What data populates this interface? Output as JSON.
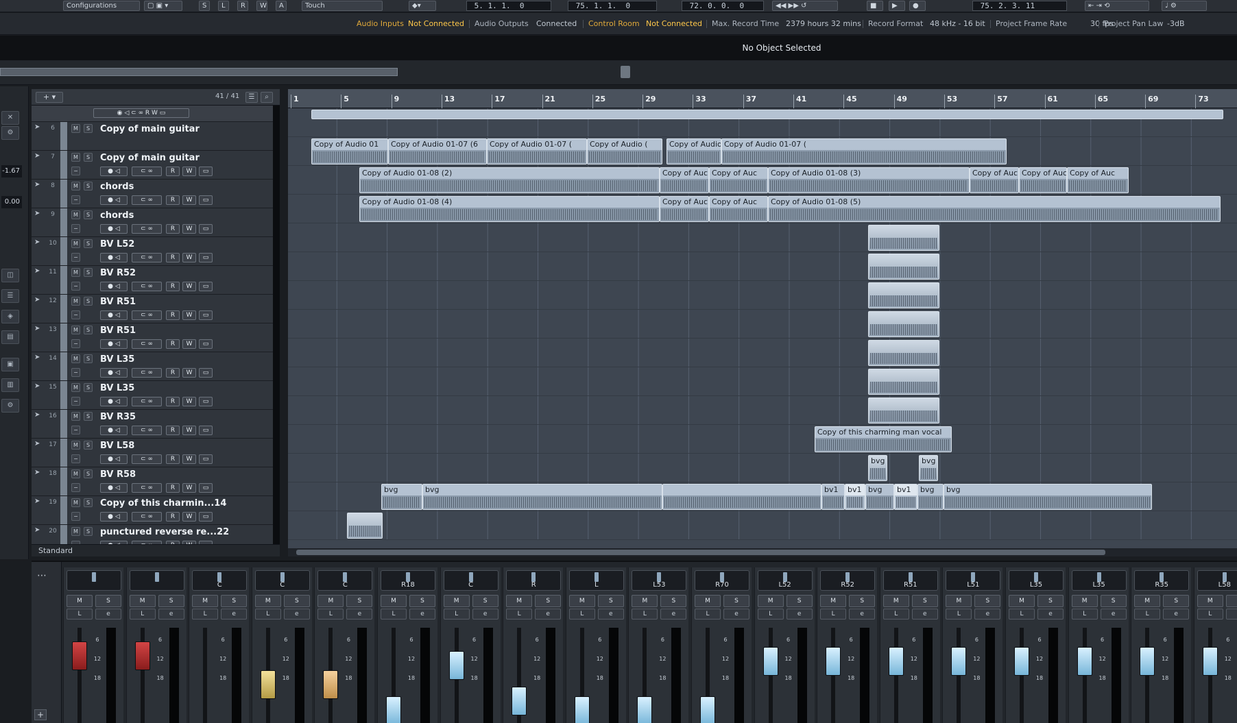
{
  "toolbar": {
    "configurations": "Configurations",
    "mode": "Touch",
    "buttons": [
      "S",
      "L",
      "R",
      "W",
      "A"
    ],
    "pos_left": " 5. 1. 1.  0",
    "pos_right": " 75. 1. 1.  0",
    "pos_main": " 72. 0. 0.  0",
    "pos_tempo": " 75. 2. 3. 11"
  },
  "status": {
    "audio_inputs_label": "Audio Inputs",
    "audio_inputs_value": "Not Connected",
    "audio_outputs_label": "Audio Outputs",
    "audio_outputs_value": "Connected",
    "control_room_label": "Control Room",
    "control_room_value": "Not Connected",
    "max_record_label": "Max. Record Time",
    "max_record_value": "2379 hours 32 mins",
    "record_format_label": "Record Format",
    "record_format_value": "48 kHz - 16 bit",
    "frame_rate_label": "Project Frame Rate",
    "frame_rate_value": "30 fps",
    "pan_law_label": "Project Pan Law",
    "pan_law_value": "-3dB"
  },
  "infoline": {
    "message": "No Object Selected"
  },
  "leftzone": {
    "value1": "-1.67",
    "value2": "0.00"
  },
  "tracklist": {
    "count": "41 / 41",
    "footer": "Standard",
    "tracks": [
      {
        "num": "6",
        "name": "Copy of main guitar",
        "has_controls": false
      },
      {
        "num": "7",
        "name": "Copy of main guitar",
        "has_controls": true
      },
      {
        "num": "8",
        "name": "chords",
        "has_controls": true
      },
      {
        "num": "9",
        "name": "chords",
        "has_controls": true
      },
      {
        "num": "10",
        "name": "BV L52",
        "has_controls": true
      },
      {
        "num": "11",
        "name": "BV R52",
        "has_controls": true
      },
      {
        "num": "12",
        "name": "BV R51",
        "has_controls": true
      },
      {
        "num": "13",
        "name": "BV R51",
        "has_controls": true
      },
      {
        "num": "14",
        "name": "BV L35",
        "has_controls": true
      },
      {
        "num": "15",
        "name": "BV L35",
        "has_controls": true
      },
      {
        "num": "16",
        "name": "BV R35",
        "has_controls": true
      },
      {
        "num": "17",
        "name": "BV L58",
        "has_controls": true
      },
      {
        "num": "18",
        "name": "BV R58",
        "has_controls": true
      },
      {
        "num": "19",
        "name": "Copy of this charmin...14",
        "has_controls": true
      },
      {
        "num": "20",
        "name": "punctured reverse re...22",
        "has_controls": true
      }
    ]
  },
  "ruler": [
    "1",
    "5",
    "9",
    "13",
    "17",
    "21",
    "25",
    "29",
    "33",
    "37",
    "41",
    "45",
    "49",
    "53",
    "57",
    "61",
    "65",
    "69",
    "73"
  ],
  "clips": {
    "guitar1": [
      "Copy of Audio 01",
      "Copy of Audio 01-07 (6",
      "Copy of Audio 01-07 (",
      "Copy of Audio (",
      "Copy of Audio 0",
      "Copy of Audio 01-07 ("
    ],
    "chords1": [
      "Copy of Audio 01-08 (2)",
      "Copy of Auc",
      "Copy of Auc",
      "Copy of Audio 01-08 (3)",
      "Copy of Auc",
      "Copy of Auc",
      "Copy of Auc"
    ],
    "chords2": [
      "Copy of Audio 01-08 (4)",
      "Copy of Auc",
      "Copy of Auc",
      "Copy of Audio 01-08 (5)"
    ],
    "vocal": "Copy of this charming man vocal",
    "bvg": "bvg",
    "bv1": "bv1"
  },
  "mixer": {
    "strips": [
      {
        "pan": "",
        "fader": "red"
      },
      {
        "pan": "",
        "fader": "red"
      },
      {
        "pan": "C",
        "fader": "none"
      },
      {
        "pan": "C",
        "fader": "yellow"
      },
      {
        "pan": "C",
        "fader": "orange"
      },
      {
        "pan": "R18",
        "fader": "blue"
      },
      {
        "pan": "C",
        "fader": "blue"
      },
      {
        "pan": "R",
        "fader": "blue"
      },
      {
        "pan": "L",
        "fader": "blue"
      },
      {
        "pan": "L53",
        "fader": "blue"
      },
      {
        "pan": "R70",
        "fader": "blue"
      },
      {
        "pan": "L52",
        "fader": "blue"
      },
      {
        "pan": "R52",
        "fader": "blue"
      },
      {
        "pan": "R51",
        "fader": "blue"
      },
      {
        "pan": "L51",
        "fader": "blue"
      },
      {
        "pan": "L35",
        "fader": "blue"
      },
      {
        "pan": "L35",
        "fader": "blue"
      },
      {
        "pan": "R35",
        "fader": "blue"
      },
      {
        "pan": "L58",
        "fader": "blue"
      }
    ],
    "scale": [
      "6",
      "12",
      "18"
    ]
  }
}
